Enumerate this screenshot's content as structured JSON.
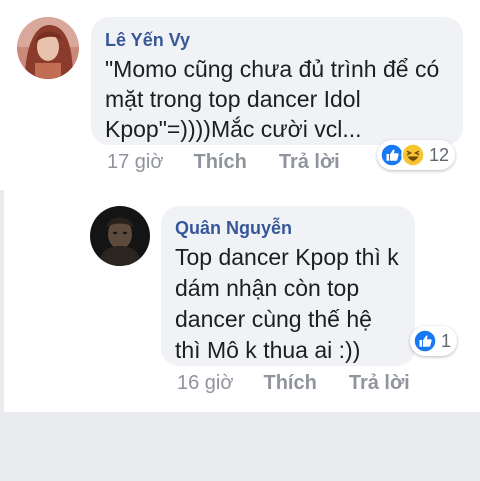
{
  "comments": [
    {
      "author": "Lê Yến Vy",
      "text": "\"Momo cũng chưa đủ trình để có mặt trong top dancer Idol Kpop\"=))))Mắc cười vcl...",
      "time": "17 giờ",
      "like_label": "Thích",
      "reply_label": "Trả lời",
      "reactions": {
        "icons": [
          "like-icon",
          "haha-icon"
        ],
        "count": "12"
      }
    },
    {
      "author": "Quân Nguyễn",
      "text": "Top dancer Kpop thì k dám nhận còn top dancer cùng thế hệ thì Mô k thua ai :))",
      "time": "16 giờ",
      "like_label": "Thích",
      "reply_label": "Trả lời",
      "reactions": {
        "icons": [
          "like-icon"
        ],
        "count": "1"
      }
    }
  ],
  "colors": {
    "author_name": "#365899",
    "meta_text": "#90949c",
    "bubble": "#f1f2f6",
    "like_blue": "#1877f2",
    "haha_yellow": "#f7c530",
    "page_gray": "#e9ebee"
  }
}
